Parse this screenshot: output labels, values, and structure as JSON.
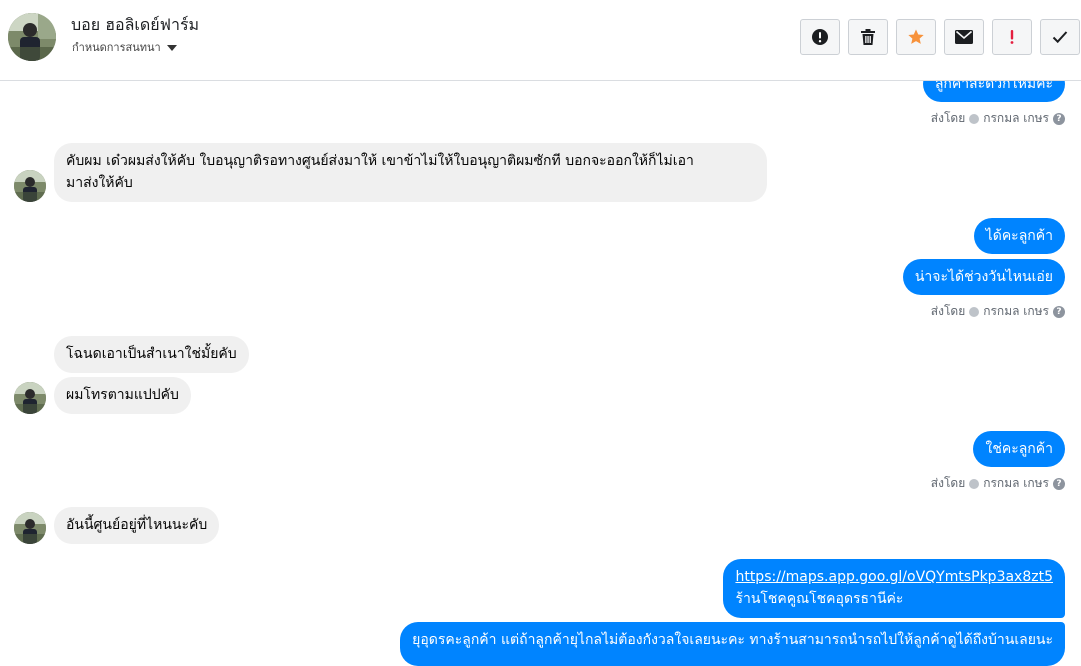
{
  "header": {
    "contact_name": "บอย ฮอลิเดย์ฟาร์ม",
    "manage_label": "กำหนดการสนทนา",
    "actions": [
      {
        "name": "spam-button",
        "icon": "alert-circle-icon"
      },
      {
        "name": "delete-button",
        "icon": "trash-icon"
      },
      {
        "name": "star-button",
        "icon": "star-icon",
        "color": "#f7923b"
      },
      {
        "name": "mark-unread-button",
        "icon": "envelope-icon"
      },
      {
        "name": "follow-up-button",
        "icon": "exclamation-icon",
        "color": "#e41e3f"
      },
      {
        "name": "mark-done-button",
        "icon": "checkmark-icon"
      }
    ]
  },
  "sent_by": {
    "prefix": "ส่งโดย",
    "name": "กรกมล เกษร",
    "help": "?"
  },
  "messages": {
    "m0": "ลูกค้าสะดวกไหมคะ",
    "m1_l1": "คับผม เด๋วผมส่งให้คับ ใบอนุญาติรอทางศูนย์ส่งมาให้ เขาข้าไม่ให้ใบอนุญาติผมซักที บอกจะออกให้ก็ไม่เอา",
    "m1_l2": "มาส่งให้คับ",
    "m2": "ได้คะลูกค้า",
    "m3": "น่าจะได้ช่วงวันไหนเอ่ย",
    "m4": "โฉนดเอาเป็นสำเนาใช่มั้ยคับ",
    "m5": "ผมโทรตามแปปคับ",
    "m6": "ใช่คะลูกค้า",
    "m7": "อันนี้ศูนย์อยู่ที่ไหนนะคับ",
    "m8_link": "https://maps.app.goo.gl/oVQYmtsPkp3ax8zt5",
    "m8_l2": "ร้านโชคคูณโชคอุดรธานีค่ะ",
    "m9": "ยุอุดรคะลูกค้า แต่ถ้าลูกค้ายุไกลไม่ต้องกังวลใจเลยนะคะ ทางร้านสามารถนำรถไปให้ลูกค้าดูได้ถึงบ้านเลยนะ"
  },
  "colors": {
    "outgoing": "#0084ff",
    "incoming": "#f0f0f0",
    "divider": "#dadde1"
  }
}
